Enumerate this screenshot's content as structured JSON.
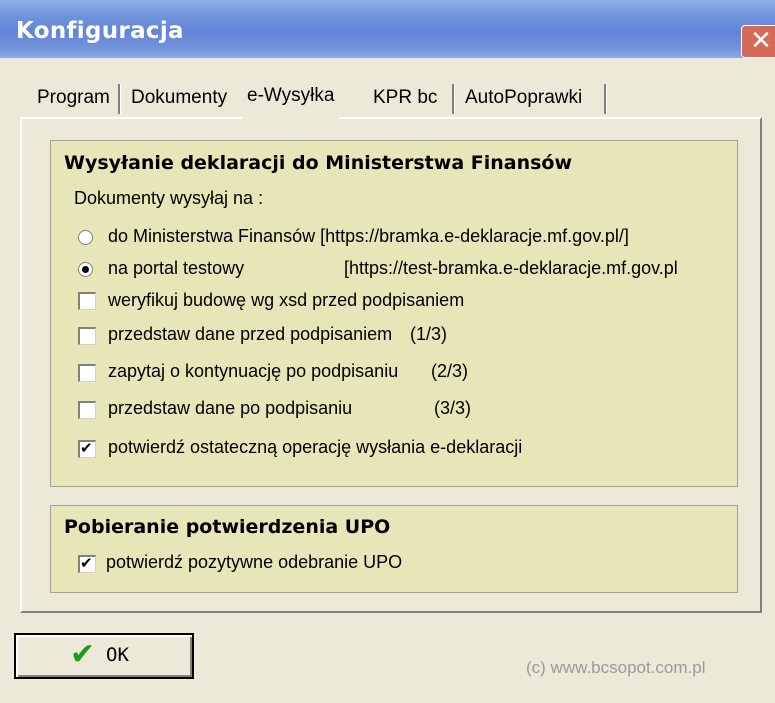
{
  "window": {
    "title": "Konfiguracja",
    "close_glyph": "✕"
  },
  "tabs": [
    {
      "label": "Program",
      "selected": false
    },
    {
      "label": "Dokumenty",
      "selected": false
    },
    {
      "label": "e-Wysyłka",
      "selected": true
    },
    {
      "label": "KPR bc",
      "selected": false
    },
    {
      "label": "AutoPoprawki",
      "selected": false
    }
  ],
  "send_group": {
    "title": "Wysyłanie deklaracji do Ministerstwa Finansów",
    "subtitle": "Dokumenty wysyłaj na :",
    "radios": [
      {
        "label": "do Ministerstwa Finansów [https://bramka.e-deklaracje.mf.gov.pl/]",
        "checked": false
      },
      {
        "label": "na portal testowy",
        "url": "[https://test-bramka.e-deklaracje.mf.gov.pl",
        "checked": true
      }
    ],
    "checkboxes": [
      {
        "label": "weryfikuj budowę wg xsd przed podpisaniem",
        "step": "",
        "checked": false
      },
      {
        "label": "przedstaw dane przed podpisaniem",
        "step": "(1/3)",
        "checked": false
      },
      {
        "label": "zapytaj o kontynuację po podpisaniu",
        "step": "(2/3)",
        "checked": false
      },
      {
        "label": "przedstaw dane po podpisaniu",
        "step": "(3/3)",
        "checked": false
      },
      {
        "label": "potwierdź ostateczną operację wysłania e-deklaracji",
        "step": "",
        "checked": true
      }
    ]
  },
  "upo_group": {
    "title": "Pobieranie potwierdzenia UPO",
    "checkbox": {
      "label": "potwierdź pozytywne odebranie UPO",
      "checked": true
    }
  },
  "ok_button": {
    "label": "OK",
    "icon": "green-check-icon",
    "color": "#1d9b1d"
  },
  "copyright": "(c) www.bcsopot.com.pl"
}
